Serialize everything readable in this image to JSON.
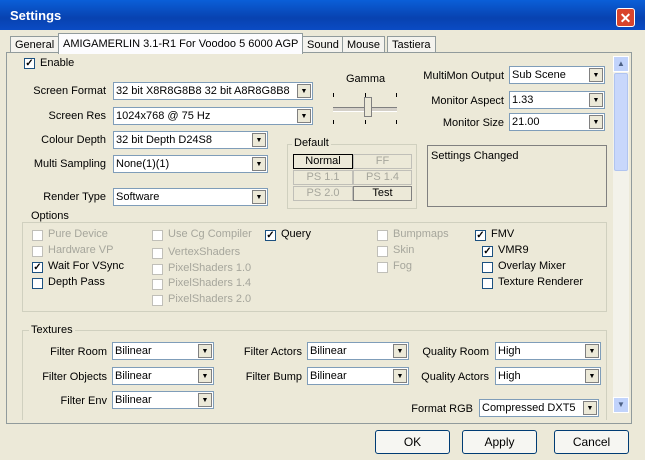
{
  "window": {
    "title": "Settings",
    "close_glyph": "✕"
  },
  "tabs": [
    "General",
    "AMIGAMERLIN 3.1-R1 For Voodoo 5 6000 AGP",
    "Sound",
    "Mouse",
    "Tastiera"
  ],
  "enable": {
    "label": "Enable",
    "checked": true
  },
  "display": {
    "screen_format": {
      "label": "Screen Format",
      "value": "32 bit X8R8G8B8 32 bit A8R8G8B8"
    },
    "screen_res": {
      "label": "Screen Res",
      "value": "1024x768 @ 75 Hz"
    },
    "colour_depth": {
      "label": "Colour Depth",
      "value": "32 bit Depth D24S8"
    },
    "multi_sampling": {
      "label": "Multi Sampling",
      "value": "None(1)(1)"
    },
    "render_type": {
      "label": "Render Type",
      "value": "Software"
    }
  },
  "gamma": {
    "label": "Gamma"
  },
  "default_group": {
    "title": "Default",
    "buttons": [
      "Normal",
      "FF",
      "PS 1.1",
      "PS 1.4",
      "PS 2.0",
      "Test"
    ]
  },
  "multimon": {
    "output": {
      "label": "MultiMon Output",
      "value": "Sub Scene"
    },
    "aspect": {
      "label": "Monitor Aspect",
      "value": "1.33"
    },
    "size": {
      "label": "Monitor Size",
      "value": "21.00"
    }
  },
  "status_text": "Settings Changed",
  "options": {
    "title": "Options",
    "col1": [
      {
        "label": "Pure Device",
        "checked": false,
        "disabled": true
      },
      {
        "label": "Hardware VP",
        "checked": false,
        "disabled": true
      },
      {
        "label": "Wait For VSync",
        "checked": true,
        "disabled": false
      },
      {
        "label": "Depth Pass",
        "checked": false,
        "disabled": false
      }
    ],
    "col2": [
      {
        "label": "Use Cg Compiler",
        "checked": false,
        "disabled": true
      },
      {
        "label": "VertexShaders",
        "checked": false,
        "disabled": true
      },
      {
        "label": "PixelShaders 1.0",
        "checked": false,
        "disabled": true
      },
      {
        "label": "PixelShaders 1.4",
        "checked": false,
        "disabled": true
      },
      {
        "label": "PixelShaders 2.0",
        "checked": false,
        "disabled": true
      }
    ],
    "query": {
      "label": "Query",
      "checked": true
    },
    "col4": [
      {
        "label": "Bumpmaps",
        "checked": false,
        "disabled": true
      },
      {
        "label": "Skin",
        "checked": false,
        "disabled": true
      },
      {
        "label": "Fog",
        "checked": false,
        "disabled": true
      }
    ],
    "fmv": {
      "label": "FMV",
      "checked": true
    },
    "fmv_sub": [
      {
        "label": "VMR9",
        "checked": true
      },
      {
        "label": "Overlay Mixer",
        "checked": false
      },
      {
        "label": "Texture Renderer",
        "checked": false
      }
    ]
  },
  "textures": {
    "title": "Textures",
    "filter_room": {
      "label": "Filter Room",
      "value": "Bilinear"
    },
    "filter_objects": {
      "label": "Filter Objects",
      "value": "Bilinear"
    },
    "filter_env": {
      "label": "Filter Env",
      "value": "Bilinear"
    },
    "filter_actors": {
      "label": "Filter Actors",
      "value": "Bilinear"
    },
    "filter_bump": {
      "label": "Filter Bump",
      "value": "Bilinear"
    },
    "quality_room": {
      "label": "Quality Room",
      "value": "High"
    },
    "quality_actors": {
      "label": "Quality Actors",
      "value": "High"
    },
    "format_rgb": {
      "label": "Format RGB",
      "value": "Compressed DXT5"
    }
  },
  "buttons": {
    "ok": "OK",
    "apply": "Apply",
    "cancel": "Cancel"
  }
}
